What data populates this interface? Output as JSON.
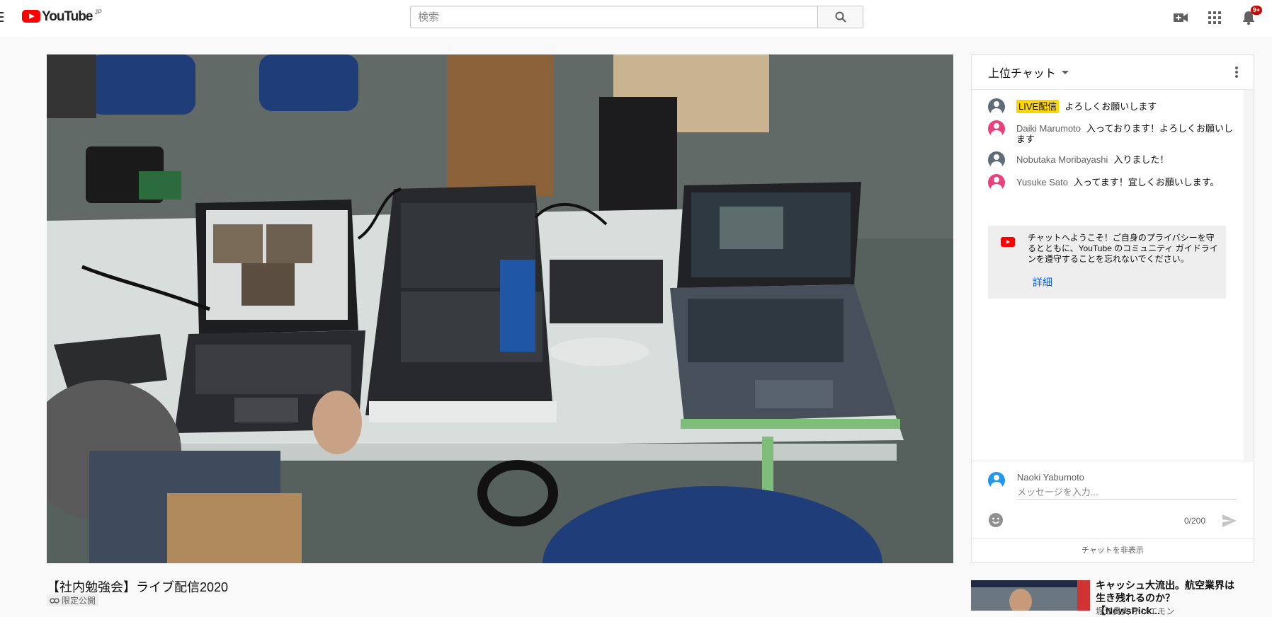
{
  "app": {
    "logo_text": "YouTube",
    "region": "JP"
  },
  "search": {
    "placeholder": "検索"
  },
  "notifications": {
    "badge": "9+"
  },
  "video": {
    "title": "【社内勉強会】ライブ配信2020",
    "visibility": "限定公開"
  },
  "chat": {
    "mode_label": "上位チャット",
    "messages": [
      {
        "badge": "LIVE配信",
        "text": "よろしくお願いします",
        "avatar": "gray"
      },
      {
        "author": "Daiki Marumoto",
        "text": "入っております！よろしくお願いします",
        "avatar": "pink"
      },
      {
        "author": "Nobutaka Moribayashi",
        "text": "入りました！",
        "avatar": "gray"
      },
      {
        "author": "Yusuke Sato",
        "text": "入ってます！宜しくお願いします。",
        "avatar": "pink"
      }
    ],
    "welcome": {
      "text": "チャットへようこそ！ご自身のプライバシーを守るとともに、YouTube のコミュニティ ガイドラインを遵守することを忘れないでください。",
      "link": "詳細"
    },
    "input": {
      "user": "Naoki Yabumoto",
      "placeholder": "メッセージを入力...",
      "count": "0/200"
    },
    "hide_label": "チャットを非表示"
  },
  "recommended": [
    {
      "title": "キャッシュ大流出。航空業界は生き残れるのか？【NewsPick...",
      "channel": "堀江貴文 ホリエモン"
    }
  ],
  "colors": {
    "brand_red": "#ff0000",
    "link_blue": "#065fd4",
    "live_badge": "#ffd600",
    "notif_red": "#cc0000"
  }
}
